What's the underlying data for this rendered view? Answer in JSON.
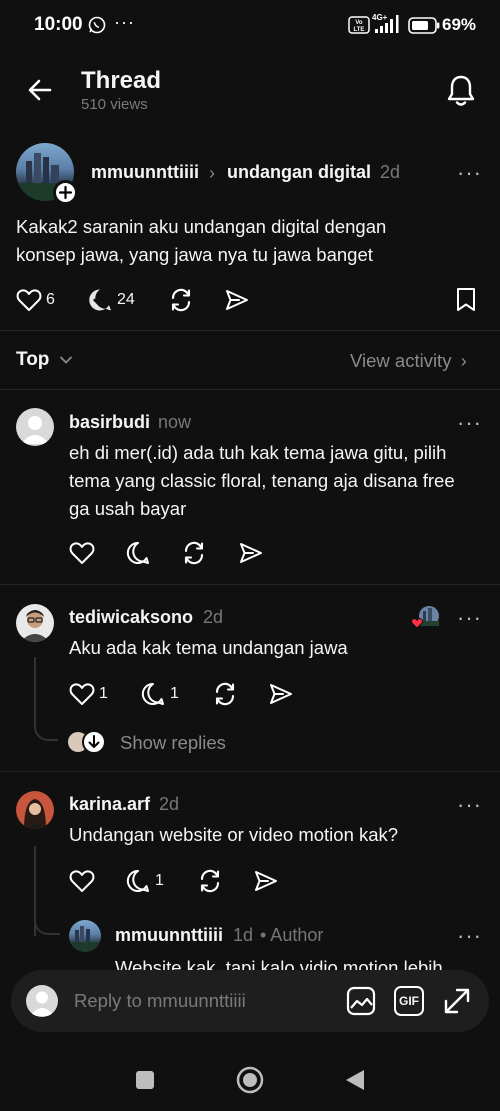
{
  "status_bar": {
    "time": "10:00",
    "dots": "···",
    "volte": "Vo LTE",
    "network": "4G+",
    "battery": "69%"
  },
  "header": {
    "title": "Thread",
    "views": "510 views",
    "icons": [
      "back-arrow-icon",
      "bell-icon"
    ]
  },
  "post": {
    "username": "mmuunnttiiii",
    "separator": "›",
    "community": "undangan digital",
    "time": "2d",
    "text_line1": "Kakak2 saranin aku undangan digital dengan",
    "text_line2": "konsep jawa, yang jawa nya tu jawa banget",
    "likes": "6",
    "replies": "24",
    "more": "···"
  },
  "sort": {
    "label": "Top",
    "view_activity": "View activity"
  },
  "comments": [
    {
      "username": "basirbudi",
      "time": "now",
      "line1": "eh di mer(.id) ada tuh kak tema jawa gitu, pilih",
      "line2": "tema yang classic floral, tenang aja disana free",
      "line3": "ga usah bayar",
      "more": "···"
    },
    {
      "username": "tediwicaksono",
      "time": "2d",
      "line1": "Aku ada kak tema undangan jawa",
      "likes": "1",
      "replies": "1",
      "show_replies": "Show replies",
      "more": "···"
    },
    {
      "username": "karina.arf",
      "time": "2d",
      "line1": "Undangan website or video motion kak?",
      "replies": "1",
      "more": "···"
    },
    {
      "username": "mmuunnttiiii",
      "time": "1d",
      "author_badge": "• Author",
      "line1": "Website kak, tapi kalo vidio motion lebih",
      "more": "···"
    }
  ],
  "reply_bar": {
    "placeholder": "Reply to mmuunnttiiii",
    "icons": [
      "image-icon",
      "gif-icon",
      "expand-icon"
    ],
    "gif_label": "GIF"
  },
  "colors": {
    "background": "#101010",
    "text": "#f3f5f7",
    "muted": "#777777",
    "divider": "#262626",
    "heart_red": "#ff3040"
  }
}
